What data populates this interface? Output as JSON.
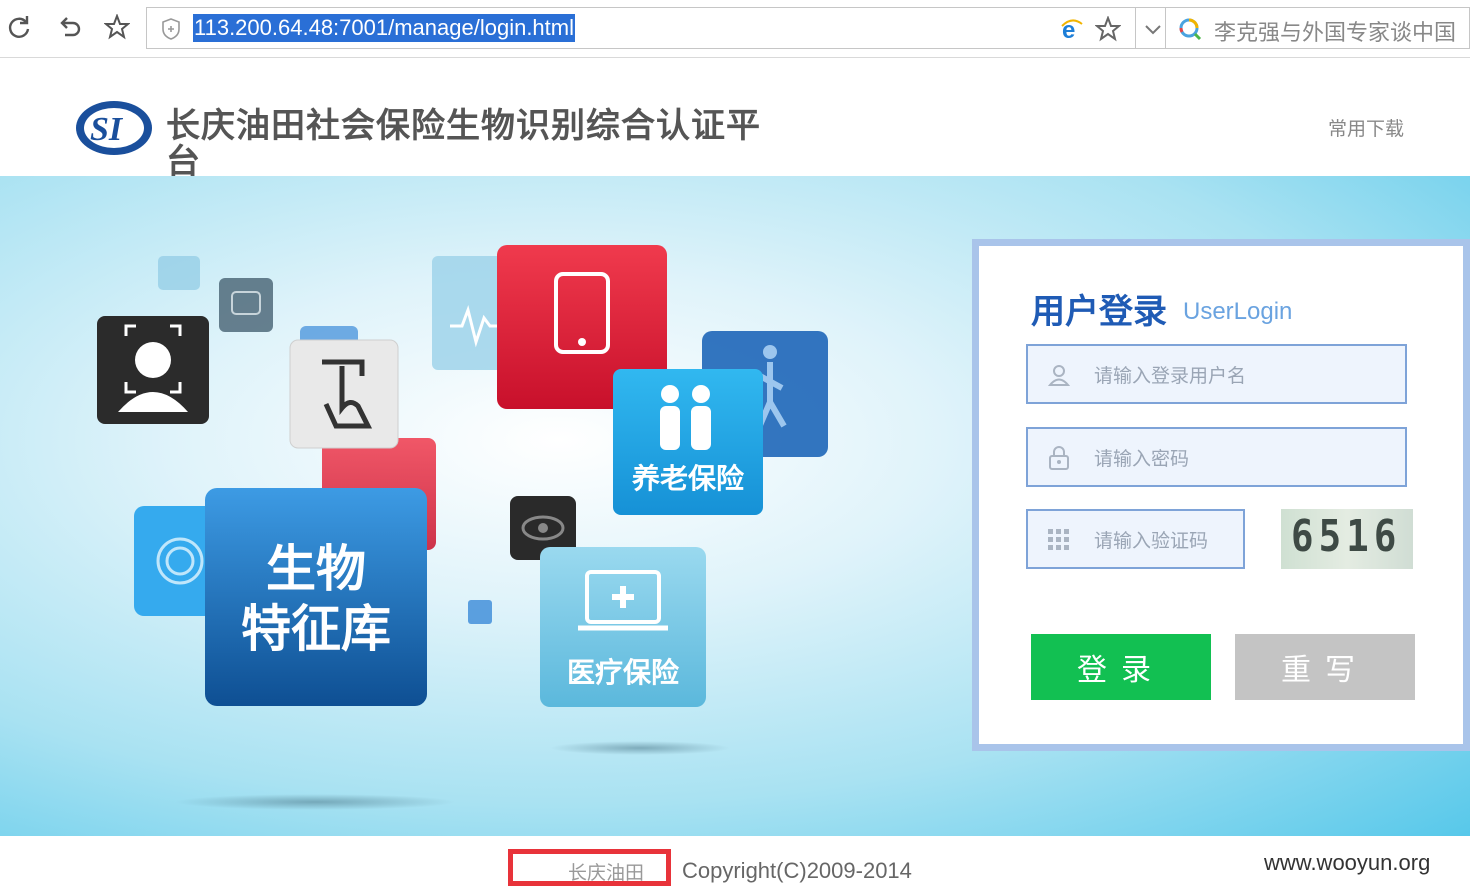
{
  "browser": {
    "url": "113.200.64.48:7001/manage/login.html",
    "search_text": "李克强与外国专家谈中国"
  },
  "header": {
    "title": "长庆油田社会保险生物识别综合认证平台",
    "downloads_link": "常用下载",
    "logo_text": "SI"
  },
  "banner": {
    "tile_biometric": "生物\n特征库",
    "tile_pension": "养老保险",
    "tile_medical": "医疗保险"
  },
  "login": {
    "title": "用户登录",
    "subtitle": "UserLogin",
    "username_placeholder": "请输入登录用户名",
    "password_placeholder": "请输入密码",
    "captcha_placeholder": "请输入验证码",
    "captcha_code": "6516",
    "login_label": "登录",
    "reset_label": "重写"
  },
  "footer": {
    "company": "长庆油田",
    "copyright": "Copyright(C)2009-2014",
    "watermark": "www.wooyun.org"
  },
  "colors": {
    "accent_blue": "#1f5bb5",
    "login_green": "#12c052",
    "reset_gray": "#c4c4c4",
    "highlight_red": "#e8333a"
  }
}
